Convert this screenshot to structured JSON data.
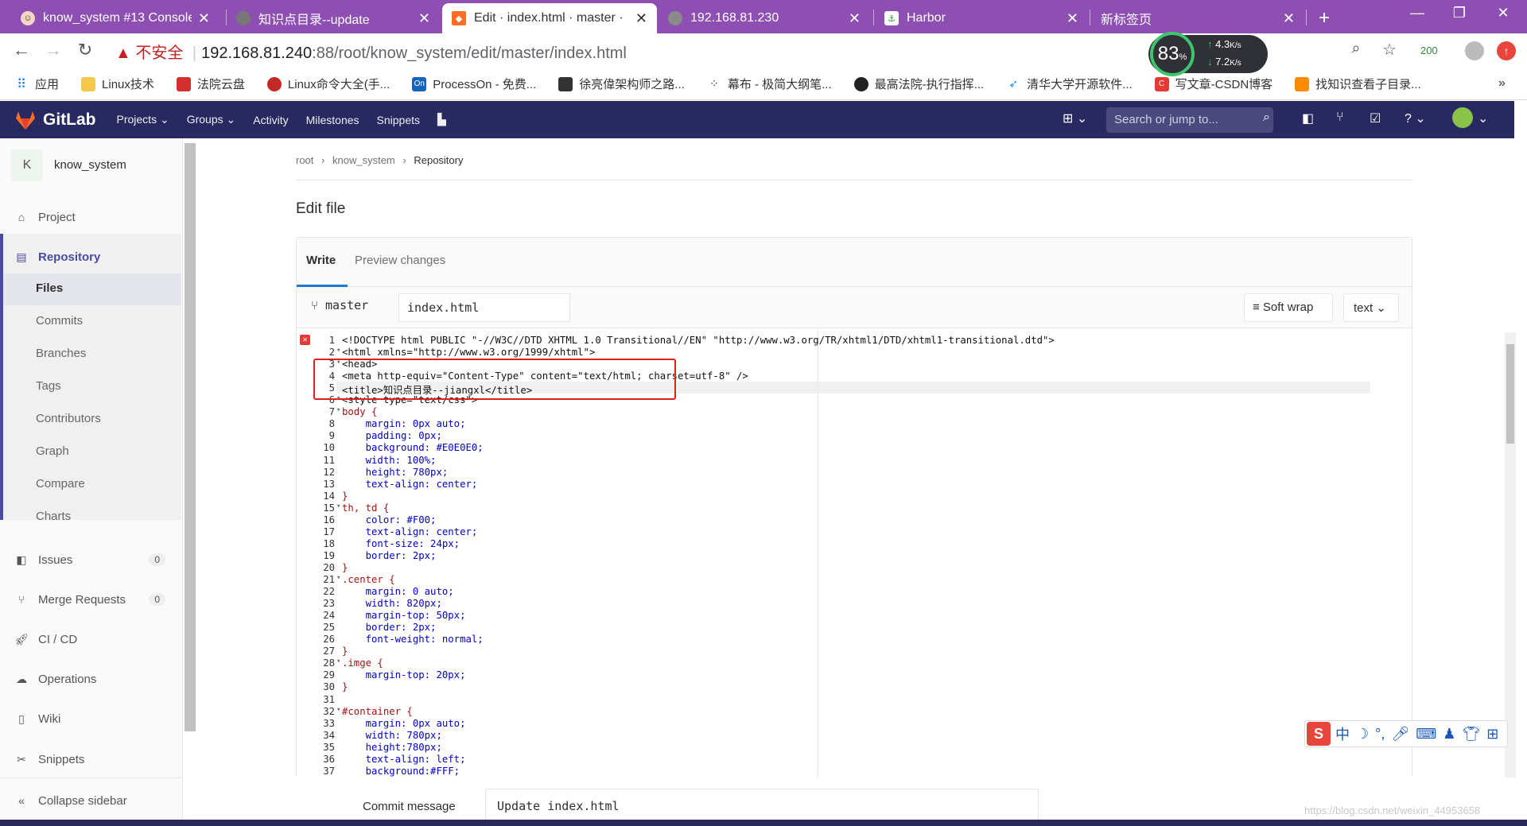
{
  "browser": {
    "tabs": [
      {
        "title": "know_system #13 Console",
        "active": false
      },
      {
        "title": "知识点目录--update",
        "active": false
      },
      {
        "title": "Edit · index.html · master ·",
        "active": true
      },
      {
        "title": "192.168.81.230",
        "active": false
      },
      {
        "title": "Harbor",
        "active": false
      },
      {
        "title": "新标签页",
        "active": false
      }
    ],
    "new_tab": "+",
    "security_label": "不安全",
    "url_host": "192.168.81.240",
    "url_path": ":88/root/know_system/edit/master/index.html",
    "speed_widget": {
      "percent": "83",
      "unit": "%",
      "up": "4.3",
      "down": "7.2",
      "speed_unit": "K/s"
    },
    "ext_badge": "200",
    "bookmarks": [
      "应用",
      "Linux技术",
      "法院云盘",
      "Linux命令大全(手...",
      "ProcessOn - 免费...",
      "徐亮偉架构师之路...",
      "幕布 - 极简大纲笔...",
      "最高法院-执行指挥...",
      "清华大学开源软件...",
      "写文章-CSDN博客",
      "找知识查看子目录..."
    ],
    "bookmarks_more": "»"
  },
  "gitlab": {
    "brand": "GitLab",
    "nav": [
      "Projects",
      "Groups",
      "Activity",
      "Milestones",
      "Snippets"
    ],
    "search_placeholder": "Search or jump to..."
  },
  "sidebar": {
    "avatar_letter": "K",
    "project_name": "know_system",
    "items": [
      {
        "label": "Project"
      },
      {
        "label": "Repository",
        "active": true
      },
      {
        "label": "Issues",
        "count": "0"
      },
      {
        "label": "Merge Requests",
        "count": "0"
      },
      {
        "label": "CI / CD"
      },
      {
        "label": "Operations"
      },
      {
        "label": "Wiki"
      },
      {
        "label": "Snippets"
      }
    ],
    "repository_sub": [
      "Files",
      "Commits",
      "Branches",
      "Tags",
      "Contributors",
      "Graph",
      "Compare",
      "Charts"
    ],
    "collapse": "Collapse sidebar"
  },
  "breadcrumb": [
    "root",
    "know_system",
    "Repository"
  ],
  "page_title": "Edit file",
  "editor": {
    "tab_write": "Write",
    "tab_preview": "Preview changes",
    "branch": "master",
    "filename": "index.html",
    "soft_wrap": "Soft wrap",
    "mode": "text",
    "lines": [
      "<!DOCTYPE html PUBLIC \"-//W3C//DTD XHTML 1.0 Transitional//EN\" \"http://www.w3.org/TR/xhtml1/DTD/xhtml1-transitional.dtd\">",
      "<html xmlns=\"http://www.w3.org/1999/xhtml\">",
      "<head>",
      "<meta http-equiv=\"Content-Type\" content=\"text/html; charset=utf-8\" />",
      "<title>知识点目录--jiangxl</title>",
      "<style type=\"text/css\">",
      "body {",
      "    margin: 0px auto;",
      "    padding: 0px;",
      "    background: #E0E0E0;",
      "    width: 100%;",
      "    height: 780px;",
      "    text-align: center;",
      "}",
      "th, td {",
      "    color: #F00;",
      "    text-align: center;",
      "    font-size: 24px;",
      "    border: 2px;",
      "}",
      ".center {",
      "    margin: 0 auto;",
      "    width: 820px;",
      "    margin-top: 50px;",
      "    border: 2px;",
      "    font-weight: normal;",
      "}",
      ".imge {",
      "    margin-top: 20px;",
      "}",
      "",
      "#container {",
      "    margin: 0px auto;",
      "    width: 780px;",
      "    height:780px;",
      "    text-align: left;",
      "    background:#FFF;"
    ]
  },
  "commit": {
    "label": "Commit message",
    "value": "Update index.html"
  },
  "ime": {
    "chars": "中"
  },
  "watermark": "https://blog.csdn.net/weixin_44953658"
}
